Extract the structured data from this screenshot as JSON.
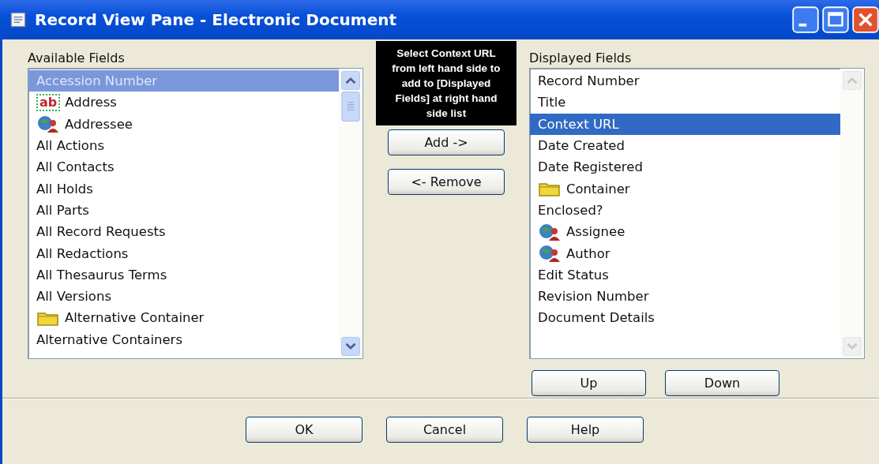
{
  "window": {
    "title": "Record View Pane - Electronic Document"
  },
  "available_fields": {
    "label": "Available Fields",
    "focused": false,
    "items": [
      {
        "label": "Accession Number",
        "kind": "plain",
        "selected": true
      },
      {
        "label": "Address",
        "kind": "text_field",
        "icon_text": "ab",
        "selected": false
      },
      {
        "label": "Addressee",
        "kind": "people",
        "selected": false
      },
      {
        "label": "All Actions",
        "kind": "plain",
        "selected": false
      },
      {
        "label": "All Contacts",
        "kind": "plain",
        "selected": false
      },
      {
        "label": "All Holds",
        "kind": "plain",
        "selected": false
      },
      {
        "label": "All Parts",
        "kind": "plain",
        "selected": false
      },
      {
        "label": "All Record Requests",
        "kind": "plain",
        "selected": false
      },
      {
        "label": "All Redactions",
        "kind": "plain",
        "selected": false
      },
      {
        "label": "All Thesaurus Terms",
        "kind": "plain",
        "selected": false
      },
      {
        "label": "All Versions",
        "kind": "plain",
        "selected": false
      },
      {
        "label": "Alternative Container",
        "kind": "folder",
        "selected": false
      },
      {
        "label": "Alternative Containers",
        "kind": "plain",
        "selected": false
      }
    ]
  },
  "callout": {
    "text": "Select Context URL from left hand side to add to [Displayed Fields] at  right hand side list"
  },
  "move_buttons": [
    "Add ->",
    "<- Remove"
  ],
  "displayed_fields": {
    "label": "Displayed Fields",
    "focused": true,
    "items": [
      {
        "label": "Record Number",
        "kind": "plain",
        "selected": false
      },
      {
        "label": "Title",
        "kind": "plain",
        "selected": false
      },
      {
        "label": "Context URL",
        "kind": "plain",
        "selected": true
      },
      {
        "label": "Date Created",
        "kind": "plain",
        "selected": false
      },
      {
        "label": "Date Registered",
        "kind": "plain",
        "selected": false
      },
      {
        "label": "Container",
        "kind": "folder",
        "selected": false
      },
      {
        "label": "Enclosed?",
        "kind": "plain",
        "selected": false
      },
      {
        "label": "Assignee",
        "kind": "people",
        "selected": false
      },
      {
        "label": "Author",
        "kind": "people",
        "selected": false
      },
      {
        "label": "Edit Status",
        "kind": "plain",
        "selected": false
      },
      {
        "label": "Revision Number",
        "kind": "plain",
        "selected": false
      },
      {
        "label": "Document Details",
        "kind": "plain",
        "selected": false
      }
    ]
  },
  "order_buttons": [
    "Up",
    "Down"
  ],
  "dialog_buttons": [
    "OK",
    "Cancel",
    "Help"
  ]
}
